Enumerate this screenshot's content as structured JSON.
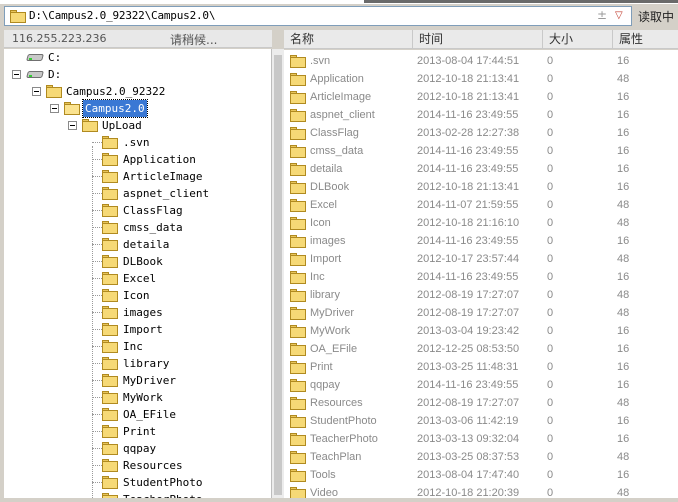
{
  "address_bar": {
    "path": "D:\\Campus2.0_92322\\Campus2.0\\",
    "clear_symbol": "±",
    "dropdown_symbol": "▽",
    "read_button": "读取中"
  },
  "left_header": {
    "ip": "116.255.223.236",
    "status": "请稍候..."
  },
  "columns": {
    "name": "名称",
    "time": "时间",
    "size": "大小",
    "attr": "属性"
  },
  "tree": {
    "drives": [
      "C:",
      "D:"
    ],
    "campus_root": "Campus2.0_92322",
    "selected": "Campus2.0",
    "upload": "UpLoad",
    "children": [
      ".svn",
      "Application",
      "ArticleImage",
      "aspnet_client",
      "ClassFlag",
      "cmss_data",
      "detaila",
      "DLBook",
      "Excel",
      "Icon",
      "images",
      "Import",
      "Inc",
      "library",
      "MyDriver",
      "MyWork",
      "OA_EFile",
      "Print",
      "qqpay",
      "Resources",
      "StudentPhoto",
      "TeacherPhoto"
    ]
  },
  "files": [
    {
      "name": ".svn",
      "time": "2013-08-04 17:44:51",
      "size": "0",
      "attr": "16"
    },
    {
      "name": "Application",
      "time": "2012-10-18 21:13:41",
      "size": "0",
      "attr": "48"
    },
    {
      "name": "ArticleImage",
      "time": "2012-10-18 21:13:41",
      "size": "0",
      "attr": "16"
    },
    {
      "name": "aspnet_client",
      "time": "2014-11-16 23:49:55",
      "size": "0",
      "attr": "16"
    },
    {
      "name": "ClassFlag",
      "time": "2013-02-28 12:27:38",
      "size": "0",
      "attr": "16"
    },
    {
      "name": "cmss_data",
      "time": "2014-11-16 23:49:55",
      "size": "0",
      "attr": "16"
    },
    {
      "name": "detaila",
      "time": "2014-11-16 23:49:55",
      "size": "0",
      "attr": "16"
    },
    {
      "name": "DLBook",
      "time": "2012-10-18 21:13:41",
      "size": "0",
      "attr": "16"
    },
    {
      "name": "Excel",
      "time": "2014-11-07 21:59:55",
      "size": "0",
      "attr": "48"
    },
    {
      "name": "Icon",
      "time": "2012-10-18 21:16:10",
      "size": "0",
      "attr": "48"
    },
    {
      "name": "images",
      "time": "2014-11-16 23:49:55",
      "size": "0",
      "attr": "16"
    },
    {
      "name": "Import",
      "time": "2012-10-17 23:57:44",
      "size": "0",
      "attr": "48"
    },
    {
      "name": "Inc",
      "time": "2014-11-16 23:49:55",
      "size": "0",
      "attr": "16"
    },
    {
      "name": "library",
      "time": "2012-08-19 17:27:07",
      "size": "0",
      "attr": "48"
    },
    {
      "name": "MyDriver",
      "time": "2012-08-19 17:27:07",
      "size": "0",
      "attr": "48"
    },
    {
      "name": "MyWork",
      "time": "2013-03-04 19:23:42",
      "size": "0",
      "attr": "16"
    },
    {
      "name": "OA_EFile",
      "time": "2012-12-25 08:53:50",
      "size": "0",
      "attr": "16"
    },
    {
      "name": "Print",
      "time": "2013-03-25 11:48:31",
      "size": "0",
      "attr": "16"
    },
    {
      "name": "qqpay",
      "time": "2014-11-16 23:49:55",
      "size": "0",
      "attr": "16"
    },
    {
      "name": "Resources",
      "time": "2012-08-19 17:27:07",
      "size": "0",
      "attr": "48"
    },
    {
      "name": "StudentPhoto",
      "time": "2013-03-06 11:42:19",
      "size": "0",
      "attr": "16"
    },
    {
      "name": "TeacherPhoto",
      "time": "2013-03-13 09:32:04",
      "size": "0",
      "attr": "16"
    },
    {
      "name": "TeachPlan",
      "time": "2013-03-25 08:37:53",
      "size": "0",
      "attr": "48"
    },
    {
      "name": "Tools",
      "time": "2013-08-04 17:47:40",
      "size": "0",
      "attr": "16"
    },
    {
      "name": "Video",
      "time": "2012-10-18 21:20:39",
      "size": "0",
      "attr": "48"
    }
  ]
}
